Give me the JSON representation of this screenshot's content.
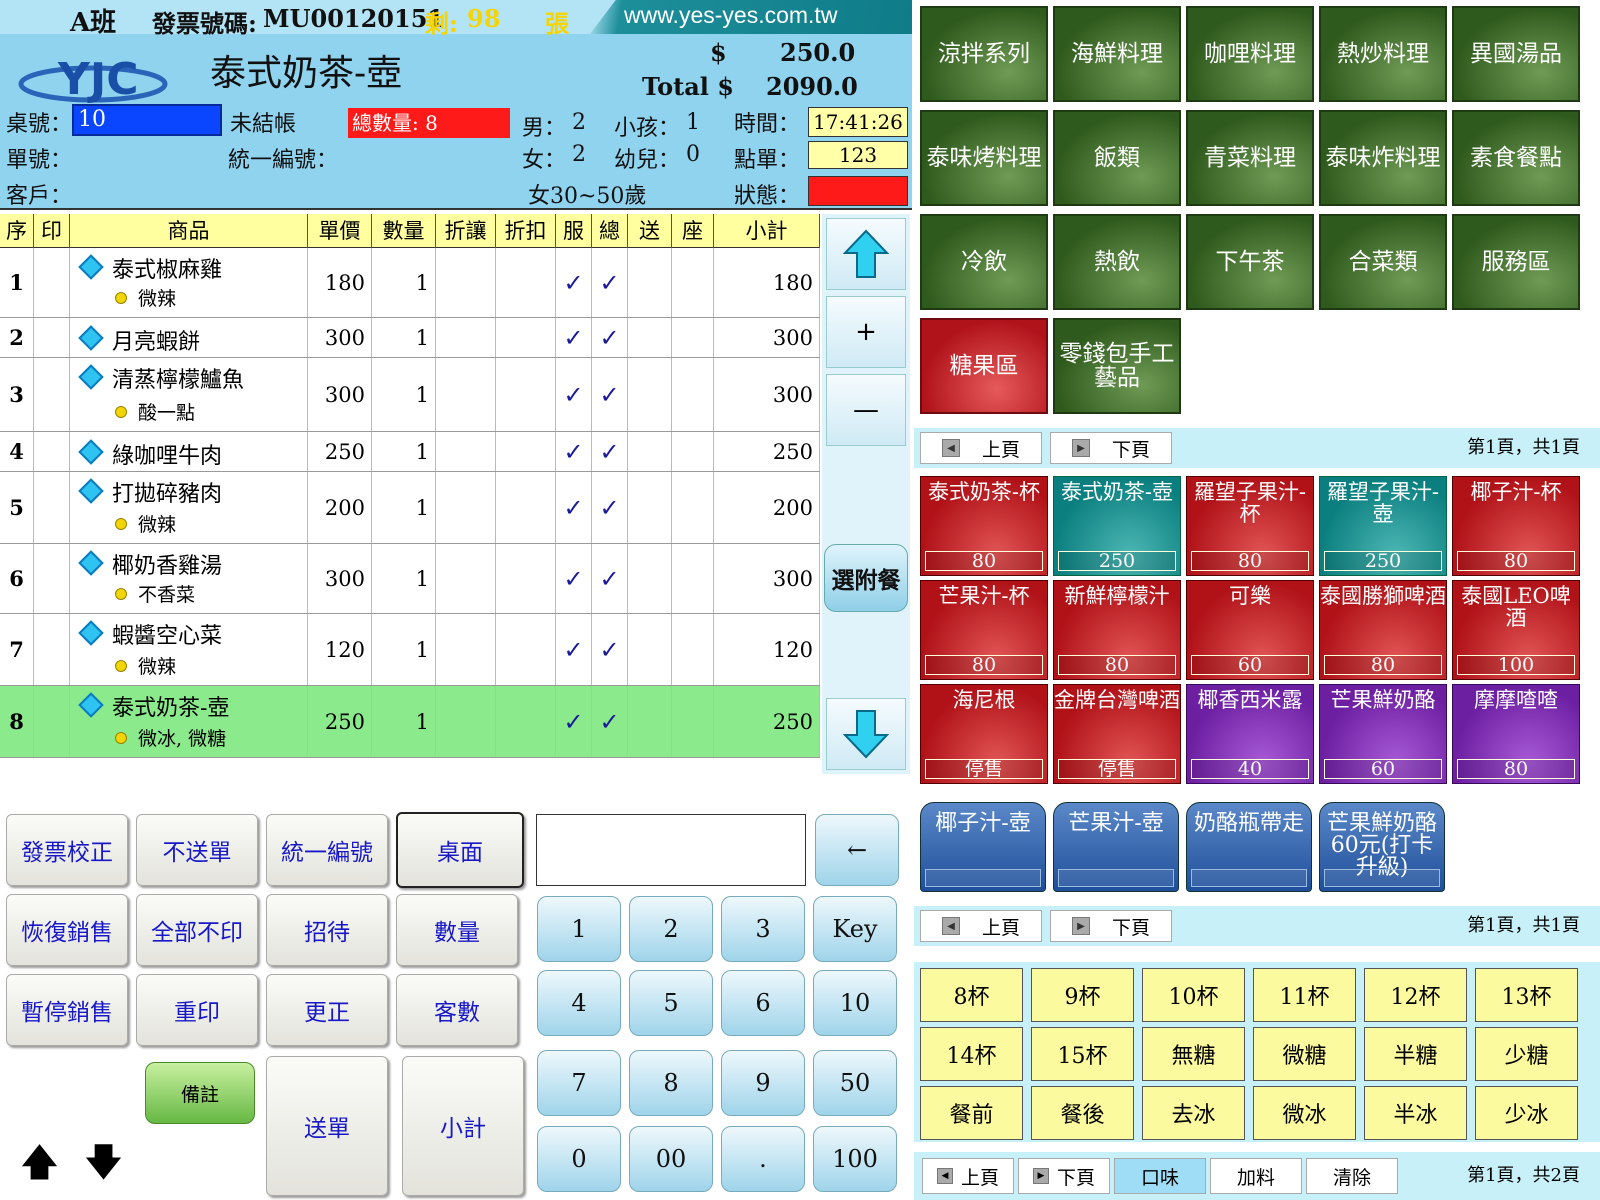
{
  "header": {
    "shift": "A班",
    "invoice_label": "發票號碼:",
    "invoice_no": "MU00120151",
    "remaining_label": "剩:",
    "remaining": "98",
    "remaining_unit": "張",
    "url": "www.yes-yes.com.tw",
    "logo_text": "YJC",
    "current_item": "泰式奶茶-壺",
    "price_symbol": "$",
    "price": "250.0",
    "total_label": "Total $",
    "total": "2090.0",
    "table_label": "桌號：",
    "table_no": "10",
    "unpaid": "未結帳",
    "qty_badge": "總數量: 8",
    "male_label": "男：",
    "male": "2",
    "child_label": "小孩：",
    "child": "1",
    "time_label": "時間：",
    "time": "17:41:26",
    "order_label": "單號：",
    "tax_label": "統一編號：",
    "female_label": "女：",
    "female": "2",
    "infant_label": "幼兒：",
    "infant": "0",
    "orderno_label": "點單：",
    "order_no": "123",
    "customer_label": "客戶：",
    "age_group": "女30~50歲",
    "status_label": "狀態："
  },
  "table": {
    "columns": [
      "序",
      "印",
      "商品",
      "單價",
      "數量",
      "折讓",
      "折扣",
      "服",
      "總",
      "送",
      "座",
      "小計"
    ],
    "rows": [
      {
        "idx": "1",
        "name": "泰式椒麻雞",
        "mod": "微辣",
        "price": "180",
        "qty": "1",
        "sub": "180"
      },
      {
        "idx": "2",
        "name": "月亮蝦餅",
        "mod": "",
        "price": "300",
        "qty": "1",
        "sub": "300"
      },
      {
        "idx": "3",
        "name": "清蒸檸檬鱸魚",
        "mod": "酸一點",
        "price": "300",
        "qty": "1",
        "sub": "300"
      },
      {
        "idx": "4",
        "name": "綠咖哩牛肉",
        "mod": "",
        "price": "250",
        "qty": "1",
        "sub": "250"
      },
      {
        "idx": "5",
        "name": "打拋碎豬肉",
        "mod": "微辣",
        "price": "200",
        "qty": "1",
        "sub": "200"
      },
      {
        "idx": "6",
        "name": "椰奶香雞湯",
        "mod": "不香菜",
        "price": "300",
        "qty": "1",
        "sub": "300"
      },
      {
        "idx": "7",
        "name": "蝦醬空心菜",
        "mod": "微辣",
        "price": "120",
        "qty": "1",
        "sub": "120"
      },
      {
        "idx": "8",
        "name": "泰式奶茶-壺",
        "mod": "微冰, 微糖",
        "price": "250",
        "qty": "1",
        "sub": "250"
      }
    ],
    "check": "✓"
  },
  "scroll": {
    "plus": "+",
    "minus": "—",
    "addon": "選附餐"
  },
  "func": {
    "invoice_fix": "發票校正",
    "no_send": "不送單",
    "tax_id": "統一編號",
    "desktop": "桌面",
    "restore": "恢復銷售",
    "no_print_all": "全部不印",
    "treat": "招待",
    "quantity": "數量",
    "pause": "暫停銷售",
    "reprint": "重印",
    "correct": "更正",
    "guests": "客數",
    "note": "備註",
    "send": "送單",
    "subtotal": "小計",
    "up": "🡅",
    "down": "🡇"
  },
  "keypad": {
    "back": "←",
    "k1": "1",
    "k2": "2",
    "k3": "3",
    "key": "Key",
    "k4": "4",
    "k5": "5",
    "k6": "6",
    "k10": "10",
    "k7": "7",
    "k8": "8",
    "k9": "9",
    "k50": "50",
    "k0": "0",
    "k00": "00",
    "dot": ".",
    "k100": "100"
  },
  "categories": [
    {
      "label": "涼拌系列",
      "color": "green"
    },
    {
      "label": "海鮮料理",
      "color": "green"
    },
    {
      "label": "咖哩料理",
      "color": "green"
    },
    {
      "label": "熱炒料理",
      "color": "green"
    },
    {
      "label": "異國湯品",
      "color": "green"
    },
    {
      "label": "泰味烤料理",
      "color": "green"
    },
    {
      "label": "飯類",
      "color": "green"
    },
    {
      "label": "青菜料理",
      "color": "green"
    },
    {
      "label": "泰味炸料理",
      "color": "green"
    },
    {
      "label": "素食餐點",
      "color": "green"
    },
    {
      "label": "冷飲",
      "color": "green"
    },
    {
      "label": "熱飲",
      "color": "green"
    },
    {
      "label": "下午茶",
      "color": "green"
    },
    {
      "label": "合菜類",
      "color": "green"
    },
    {
      "label": "服務區",
      "color": "green"
    },
    {
      "label": "糖果區",
      "color": "red"
    },
    {
      "label": "零錢包手工藝品",
      "color": "green"
    }
  ],
  "pager1": {
    "prev": "上頁",
    "next": "下頁",
    "info": "第1頁，共1頁"
  },
  "products": [
    {
      "name": "泰式奶茶-杯",
      "price": "80",
      "color": "red"
    },
    {
      "name": "泰式奶茶-壺",
      "price": "250",
      "color": "teal"
    },
    {
      "name": "羅望子果汁-杯",
      "price": "80",
      "color": "red"
    },
    {
      "name": "羅望子果汁-壺",
      "price": "250",
      "color": "teal"
    },
    {
      "name": "椰子汁-杯",
      "price": "80",
      "color": "red"
    },
    {
      "name": "芒果汁-杯",
      "price": "80",
      "color": "red"
    },
    {
      "name": "新鮮檸檬汁",
      "price": "80",
      "color": "red"
    },
    {
      "name": "可樂",
      "price": "60",
      "color": "red"
    },
    {
      "name": "泰國勝獅啤酒",
      "price": "80",
      "color": "red"
    },
    {
      "name": "泰國LEO啤酒",
      "price": "100",
      "color": "red"
    },
    {
      "name": "海尼根",
      "price": "停售",
      "color": "red"
    },
    {
      "name": "金牌台灣啤酒",
      "price": "停售",
      "color": "red"
    },
    {
      "name": "椰香西米露",
      "price": "40",
      "color": "purple"
    },
    {
      "name": "芒果鮮奶酪",
      "price": "60",
      "color": "purple"
    },
    {
      "name": "摩摩喳喳",
      "price": "80",
      "color": "purple"
    }
  ],
  "combos": [
    "椰子汁-壺",
    "芒果汁-壺",
    "奶酪瓶帶走",
    "芒果鮮奶酪60元(打卡升級)"
  ],
  "pager2": {
    "prev": "上頁",
    "next": "下頁",
    "info": "第1頁，共1頁"
  },
  "options": [
    "8杯",
    "9杯",
    "10杯",
    "11杯",
    "12杯",
    "13杯",
    "14杯",
    "15杯",
    "無糖",
    "微糖",
    "半糖",
    "少糖",
    "餐前",
    "餐後",
    "去冰",
    "微冰",
    "半冰",
    "少冰"
  ],
  "bottom": {
    "prev": "上頁",
    "next": "下頁",
    "flavor": "口味",
    "addon": "加料",
    "clear": "清除",
    "info": "第1頁，共2頁"
  },
  "colors": {
    "header_bg": "#8fd3ef",
    "selected_row": "#8bea8b",
    "alert": "#ff1a1a",
    "table_input": "#0a46ff"
  }
}
